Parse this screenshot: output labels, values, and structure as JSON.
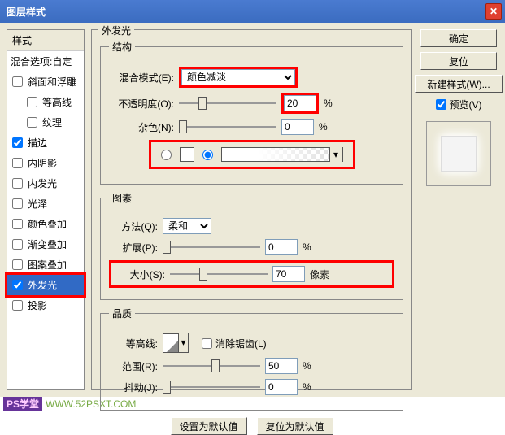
{
  "title": "图层样式",
  "left": {
    "styles_header": "样式",
    "blend_options": "混合选项:自定",
    "items": [
      {
        "label": "斜面和浮雕",
        "checked": false
      },
      {
        "label": "等高线",
        "checked": false,
        "indent": true
      },
      {
        "label": "纹理",
        "checked": false,
        "indent": true
      },
      {
        "label": "描边",
        "checked": true
      },
      {
        "label": "内阴影",
        "checked": false
      },
      {
        "label": "内发光",
        "checked": false
      },
      {
        "label": "光泽",
        "checked": false
      },
      {
        "label": "颜色叠加",
        "checked": false
      },
      {
        "label": "渐变叠加",
        "checked": false
      },
      {
        "label": "图案叠加",
        "checked": false
      },
      {
        "label": "外发光",
        "checked": true,
        "selected": true
      },
      {
        "label": "投影",
        "checked": false
      }
    ]
  },
  "center": {
    "panel_title": "外发光",
    "struct": {
      "legend": "结构",
      "blend_mode_label": "混合模式(E):",
      "blend_mode_value": "颜色减淡",
      "opacity_label": "不透明度(O):",
      "opacity_value": "20",
      "opacity_unit": "%",
      "noise_label": "杂色(N):",
      "noise_value": "0",
      "noise_unit": "%"
    },
    "elem": {
      "legend": "图素",
      "technique_label": "方法(Q):",
      "technique_value": "柔和",
      "spread_label": "扩展(P):",
      "spread_value": "0",
      "spread_unit": "%",
      "size_label": "大小(S):",
      "size_value": "70",
      "size_unit": "像素"
    },
    "quality": {
      "legend": "品质",
      "contour_label": "等高线:",
      "antialias_label": "消除锯齿(L)",
      "range_label": "范围(R):",
      "range_value": "50",
      "range_unit": "%",
      "jitter_label": "抖动(J):",
      "jitter_value": "0",
      "jitter_unit": "%"
    },
    "default_btn": "设置为默认值",
    "reset_btn": "复位为默认值"
  },
  "right": {
    "ok": "确定",
    "cancel": "复位",
    "new_style": "新建样式(W)...",
    "preview_label": "预览(V)",
    "preview_checked": true
  },
  "footer": {
    "tag": "PS学堂",
    "url": "WWW.52PSXT.COM"
  }
}
